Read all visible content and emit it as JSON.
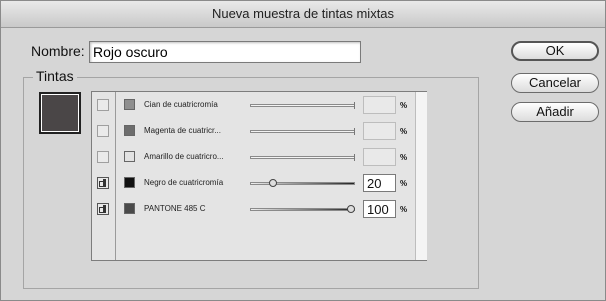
{
  "window": {
    "title": "Nueva muestra de tintas mixtas"
  },
  "name_field": {
    "label": "Nombre:",
    "value": "Rojo oscuro"
  },
  "buttons": {
    "ok": "OK",
    "cancel": "Cancelar",
    "add": "Añadir"
  },
  "inks_group": {
    "label": "Tintas"
  },
  "colors": {
    "preview_swatch": "#4a4647"
  },
  "inks": [
    {
      "name": "Cian de cuatricromía",
      "percent": "",
      "included": false,
      "chip_color": "#8f8f8f"
    },
    {
      "name": "Magenta de cuatricr...",
      "percent": "",
      "included": false,
      "chip_color": "#6d6d6d"
    },
    {
      "name": "Amarillo de cuatricro...",
      "percent": "",
      "included": false,
      "chip_color": "#e2e2e2"
    },
    {
      "name": "Negro de cuatricromía",
      "percent": "20",
      "included": true,
      "chip_color": "#111111",
      "level": 0.2
    },
    {
      "name": "PANTONE 485 C",
      "percent": "100",
      "included": true,
      "chip_color": "#4a4a4a",
      "level": 1.0
    }
  ],
  "percent_sign": "%"
}
